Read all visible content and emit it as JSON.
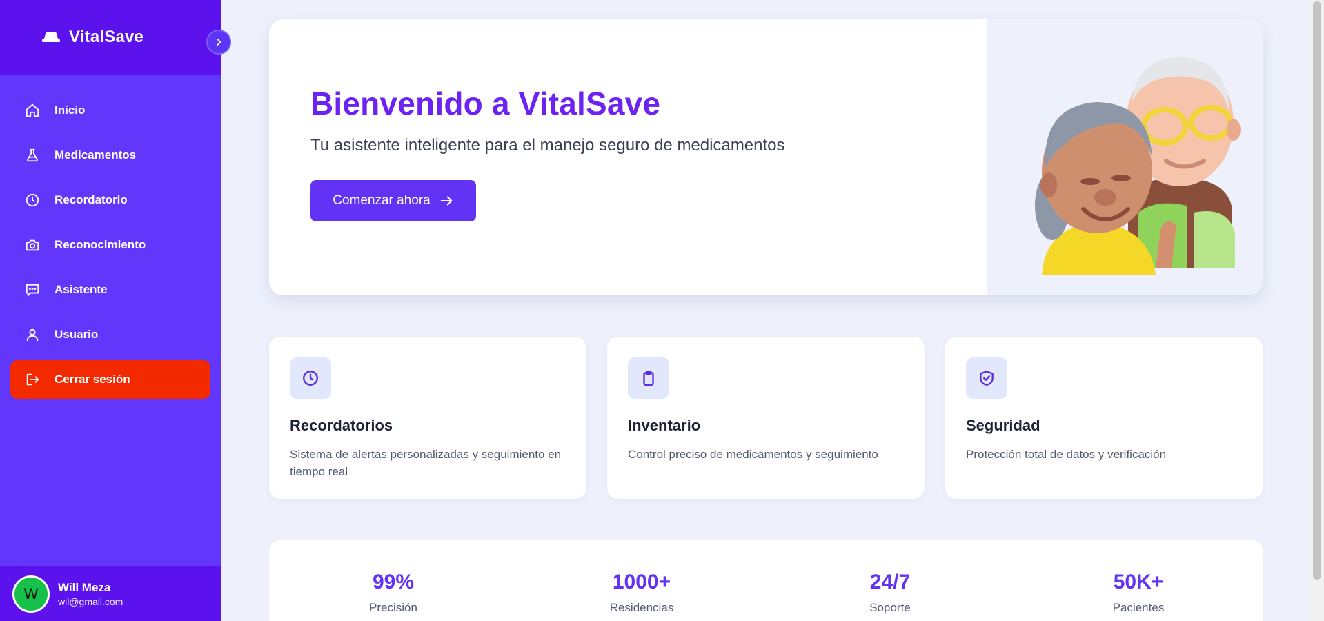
{
  "app": {
    "name": "VitalSave"
  },
  "sidebar": {
    "items": [
      {
        "label": "Inicio",
        "icon": "home-icon"
      },
      {
        "label": "Medicamentos",
        "icon": "flask-icon"
      },
      {
        "label": "Recordatorio",
        "icon": "clock-icon"
      },
      {
        "label": "Reconocimiento",
        "icon": "camera-icon"
      },
      {
        "label": "Asistente",
        "icon": "chat-icon"
      },
      {
        "label": "Usuario",
        "icon": "user-icon"
      }
    ],
    "logout": {
      "label": "Cerrar sesión",
      "icon": "logout-icon"
    }
  },
  "user": {
    "initial": "W",
    "name": "Will Meza",
    "email": "wil@gmail.com"
  },
  "hero": {
    "title": "Bienvenido a VitalSave",
    "subtitle": "Tu asistente inteligente para el manejo seguro de medicamentos",
    "cta": "Comenzar ahora"
  },
  "features": [
    {
      "title": "Recordatorios",
      "desc": "Sistema de alertas personalizadas y seguimiento en tiempo real",
      "icon": "clock-icon"
    },
    {
      "title": "Inventario",
      "desc": "Control preciso de medicamentos y seguimiento",
      "icon": "clipboard-icon"
    },
    {
      "title": "Seguridad",
      "desc": "Protección total de datos y verificación",
      "icon": "shield-check-icon"
    }
  ],
  "stats": [
    {
      "value": "99%",
      "label": "Precisión"
    },
    {
      "value": "1000+",
      "label": "Residencias"
    },
    {
      "value": "24/7",
      "label": "Soporte"
    },
    {
      "value": "50K+",
      "label": "Pacientes"
    }
  ],
  "colors": {
    "sidebar": "#6337fb",
    "sidebar_dark": "#5b12ec",
    "accent": "#6233f5",
    "title": "#6b22f3",
    "logout": "#f32a00",
    "avatar": "#17c04b"
  }
}
